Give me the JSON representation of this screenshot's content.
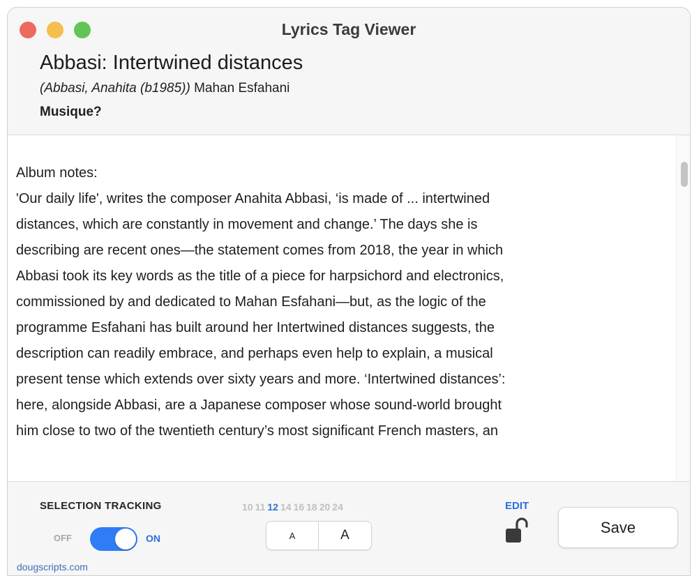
{
  "window": {
    "title": "Lyrics Tag Viewer"
  },
  "header": {
    "track_title": "Abbasi: Intertwined distances",
    "composer": "(Abbasi, Anahita (b1985))",
    "artist": "Mahan Esfahani",
    "album": "Musique?"
  },
  "content": {
    "lines": [
      "Album notes:",
      "'Our daily life', writes the composer Anahita Abbasi, ‘is made of ... intertwined",
      "distances, which are constantly in movement and change.’ The days she is",
      "describing are recent ones—the statement comes from 2018, the year in which",
      "Abbasi took its key words as the title of a piece for harpsichord and electronics,",
      "commissioned by and dedicated to Mahan Esfahani—but, as the logic of the",
      "programme Esfahani has built around her Intertwined distances suggests, the",
      "description can readily embrace, and perhaps even help to explain, a musical",
      "present tense which extends over sixty years and more. ‘Intertwined distances’:",
      "here, alongside Abbasi, are a Japanese composer whose sound-world brought",
      "him close to two of the twentieth century’s most significant French masters, an"
    ]
  },
  "footer": {
    "selection_tracking": {
      "label": "SELECTION TRACKING",
      "off_label": "OFF",
      "on_label": "ON",
      "state": "on"
    },
    "font_sizes": [
      "10",
      "11",
      "12",
      "14",
      "16",
      "18",
      "20",
      "24"
    ],
    "font_size_selected": "12",
    "size_buttons": {
      "smaller": "A",
      "larger": "A"
    },
    "edit_label": "EDIT",
    "save_label": "Save",
    "site": "dougscripts.com"
  },
  "colors": {
    "accent": "#2f7cf6",
    "close": "#ed6a5e",
    "minimize": "#f5bf4f",
    "maximize": "#61c554"
  },
  "icons": {
    "lock": "unlocked-padlock-icon"
  }
}
